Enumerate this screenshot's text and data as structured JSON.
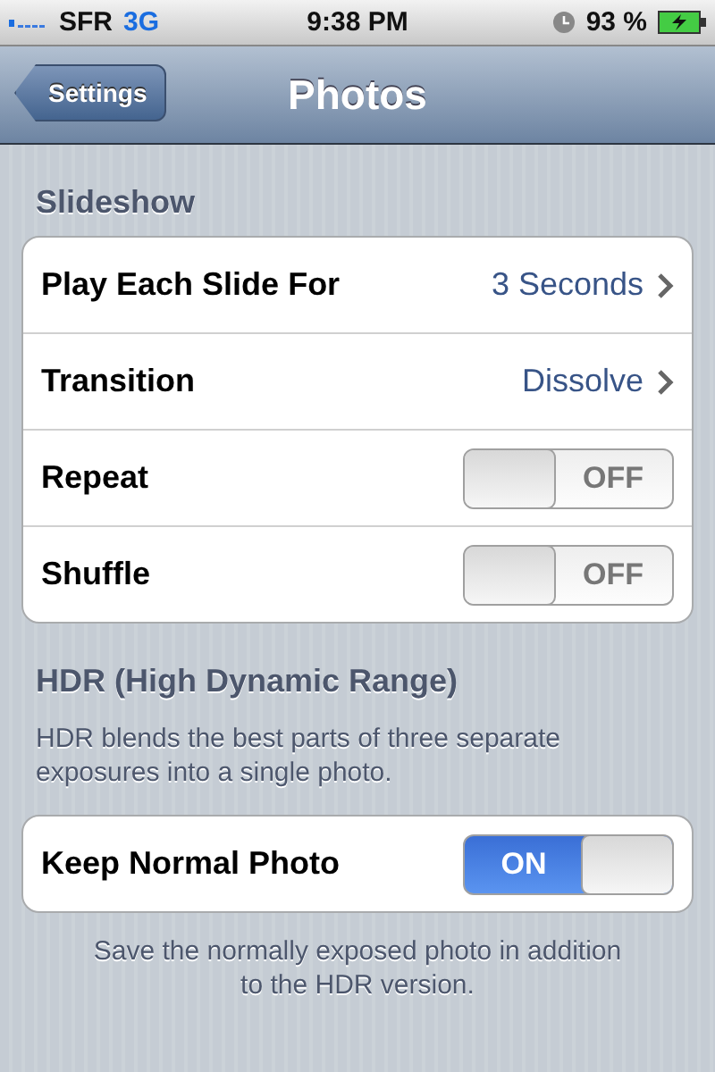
{
  "status_bar": {
    "carrier": "SFR",
    "network": "3G",
    "time": "9:38 PM",
    "battery": "93 %"
  },
  "nav": {
    "back": "Settings",
    "title": "Photos"
  },
  "sections": [
    {
      "header": "Slideshow",
      "rows": [
        {
          "kind": "value",
          "label": "Play Each Slide For",
          "value": "3 Seconds"
        },
        {
          "kind": "value",
          "label": "Transition",
          "value": "Dissolve"
        },
        {
          "kind": "switch",
          "label": "Repeat",
          "on": false,
          "switch_text": "OFF"
        },
        {
          "kind": "switch",
          "label": "Shuffle",
          "on": false,
          "switch_text": "OFF"
        }
      ]
    },
    {
      "header": "HDR (High Dynamic Range)",
      "description": "HDR blends the best parts of three separate exposures into a single photo.",
      "rows": [
        {
          "kind": "switch",
          "label": "Keep Normal Photo",
          "on": true,
          "switch_text": "ON"
        }
      ],
      "footer": "Save the normally exposed photo in addition to the HDR version."
    }
  ]
}
